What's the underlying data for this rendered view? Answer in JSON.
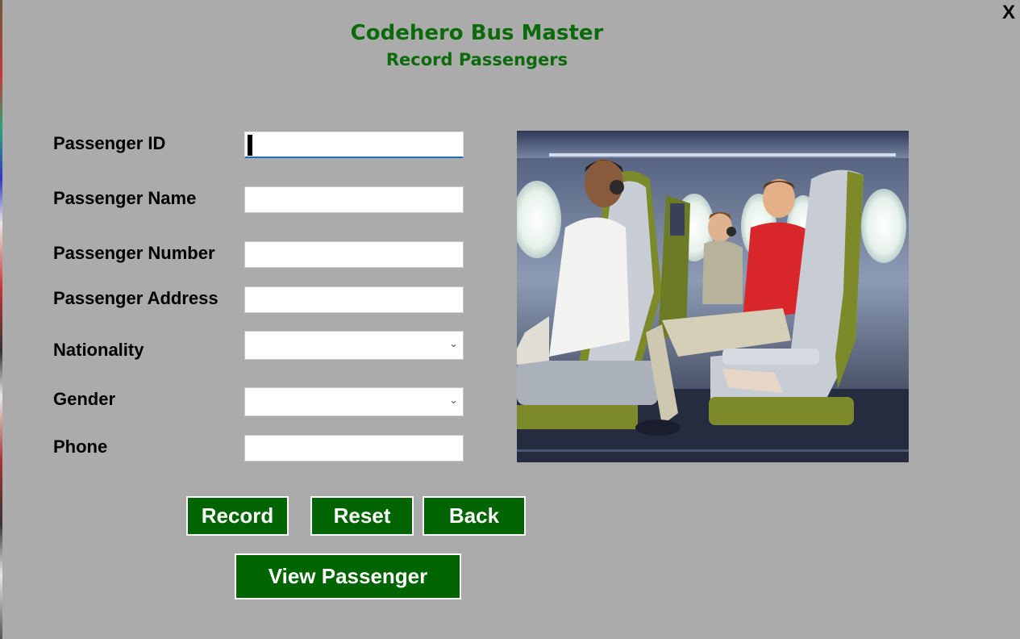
{
  "window": {
    "close_label": "X",
    "title": "Codehero Bus Master",
    "subtitle": "Record Passengers"
  },
  "form": {
    "passenger_id": {
      "label": "Passenger ID",
      "value": ""
    },
    "passenger_name": {
      "label": "Passenger Name",
      "value": ""
    },
    "passenger_number": {
      "label": "Passenger Number",
      "value": ""
    },
    "passenger_address": {
      "label": "Passenger Address",
      "value": ""
    },
    "nationality": {
      "label": "Nationality",
      "selected": ""
    },
    "gender": {
      "label": "Gender",
      "selected": ""
    },
    "phone": {
      "label": "Phone",
      "value": ""
    }
  },
  "buttons": {
    "record": "Record",
    "reset": "Reset",
    "back": "Back",
    "view_passenger": "View Passenger"
  },
  "colors": {
    "background": "#ababab",
    "title_green": "#0b6b0b",
    "button_green": "#006400"
  },
  "icons": {
    "close": "close-icon",
    "dropdown": "chevron-down-icon"
  }
}
